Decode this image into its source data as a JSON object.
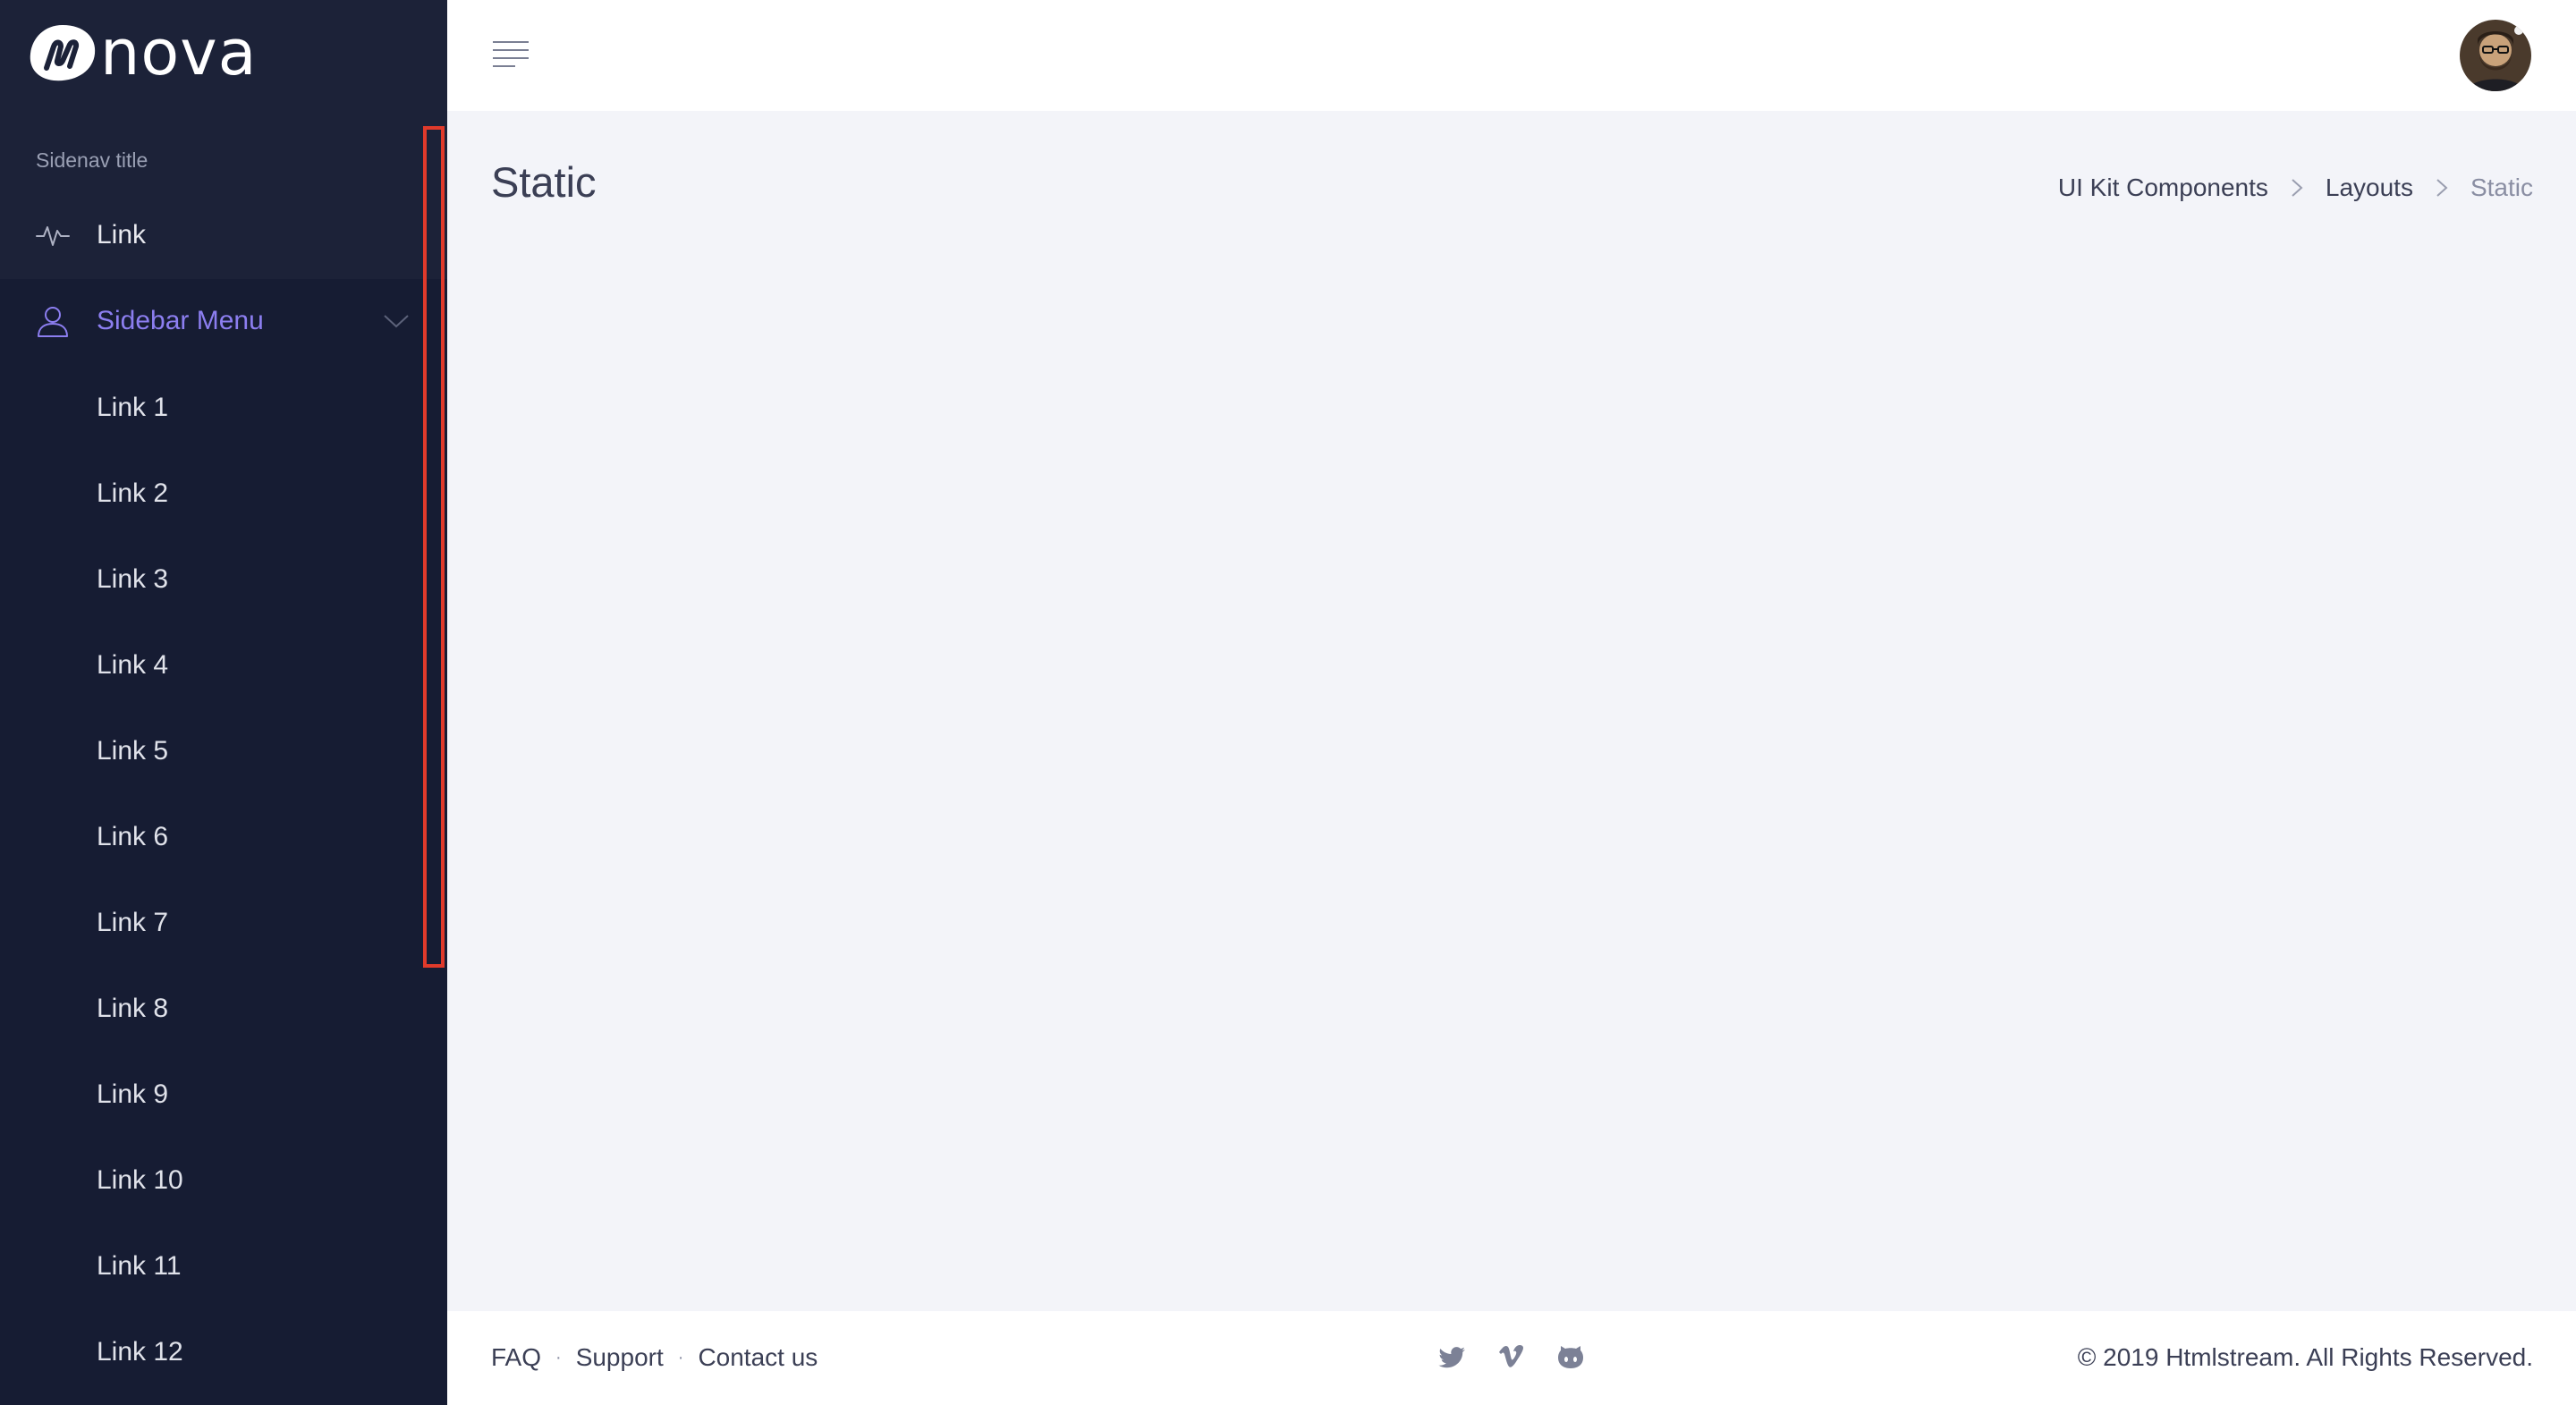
{
  "brand": {
    "name": "nova"
  },
  "sidebar": {
    "title": "Sidenav title",
    "link": {
      "label": "Link",
      "icon": "activity-icon"
    },
    "menu": {
      "label": "Sidebar Menu",
      "icon": "user-icon",
      "expanded": true,
      "items": [
        "Link 1",
        "Link 2",
        "Link 3",
        "Link 4",
        "Link 5",
        "Link 6",
        "Link 7",
        "Link 8",
        "Link 9",
        "Link 10",
        "Link 11",
        "Link 12"
      ]
    }
  },
  "main": {
    "title": "Static",
    "breadcrumb": [
      "UI Kit Components",
      "Layouts",
      "Static"
    ]
  },
  "footer": {
    "links": [
      "FAQ",
      "Support",
      "Contact us"
    ],
    "social": [
      "twitter-icon",
      "vimeo-icon",
      "github-icon"
    ],
    "copyright": "© 2019 Htmlstream. All Rights Reserved."
  },
  "colors": {
    "sidebar_bg": "#161c33",
    "accent": "#8c7ef0",
    "highlight": "#e03a2b",
    "content_bg": "#f3f4f9"
  }
}
